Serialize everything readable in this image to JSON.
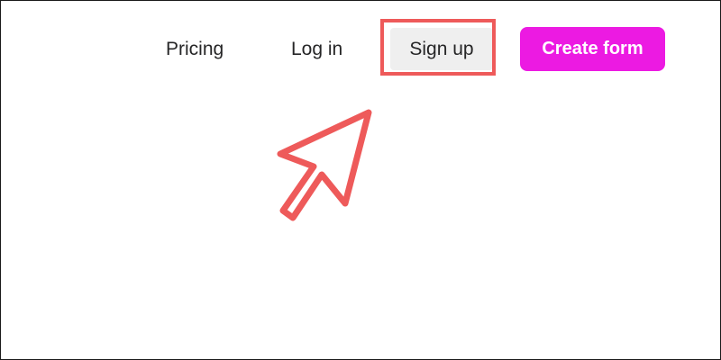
{
  "nav": {
    "pricing_label": "Pricing",
    "login_label": "Log in",
    "signup_label": "Sign up",
    "create_form_label": "Create form"
  },
  "annotation": {
    "highlight_color": "#ee5a5a",
    "arrow_icon": "pointer-arrow-icon"
  },
  "colors": {
    "accent": "#ec1ae2",
    "signup_bg": "#efefef",
    "text": "#262627"
  }
}
